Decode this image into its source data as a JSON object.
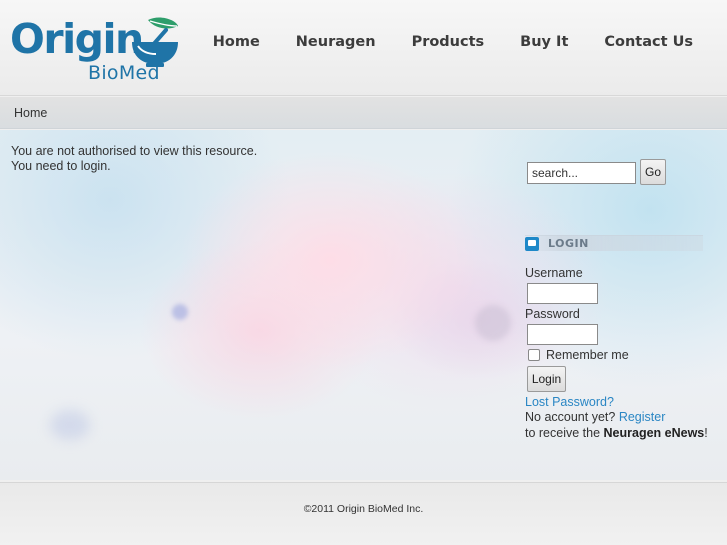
{
  "brand": {
    "name_primary": "Origin",
    "name_secondary": "BioMed",
    "colors": {
      "primary": "#1f74a7",
      "leaf": "#2e9e6b"
    }
  },
  "nav": {
    "items": [
      {
        "label": "Home"
      },
      {
        "label": "Neuragen"
      },
      {
        "label": "Products"
      },
      {
        "label": "Buy It"
      },
      {
        "label": "Contact Us"
      }
    ]
  },
  "breadcrumb": {
    "current": "Home"
  },
  "main": {
    "message_line1": "You are not authorised to view this resource.",
    "message_line2": "You need to login."
  },
  "search": {
    "placeholder": "search...",
    "button_label": "Go"
  },
  "login": {
    "title": "LOGIN",
    "username_label": "Username",
    "password_label": "Password",
    "remember_label": "Remember me",
    "submit_label": "Login",
    "lost_password_label": "Lost Password?",
    "no_account_text": "No account yet?",
    "register_label": "Register",
    "enews_prefix": "to receive the",
    "enews_name": "Neuragen eNews",
    "enews_suffix": "!"
  },
  "footer": {
    "copyright": "©2011 Origin BioMed Inc."
  }
}
